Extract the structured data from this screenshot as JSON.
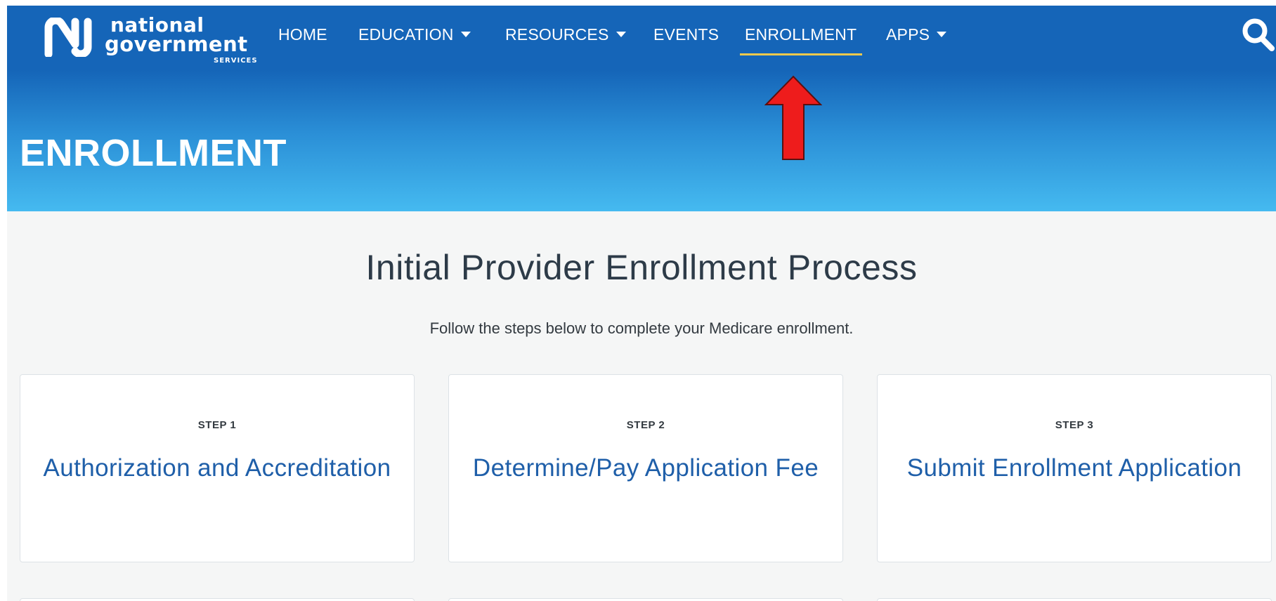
{
  "logo": {
    "line1": "national",
    "line2": "government",
    "line3": "SERVICES",
    "icon": "ngs-logo-icon"
  },
  "nav": {
    "items": [
      {
        "label": "HOME",
        "has_dropdown": false
      },
      {
        "label": "EDUCATION",
        "has_dropdown": true
      },
      {
        "label": "RESOURCES",
        "has_dropdown": true
      },
      {
        "label": "EVENTS",
        "has_dropdown": false
      },
      {
        "label": "ENROLLMENT",
        "has_dropdown": false,
        "active": true
      },
      {
        "label": "APPS",
        "has_dropdown": true
      }
    ],
    "search_icon": "search-icon"
  },
  "hero": {
    "title": "ENROLLMENT"
  },
  "annotation": {
    "icon": "red-up-arrow-icon"
  },
  "main": {
    "title": "Initial Provider Enrollment Process",
    "subtitle": "Follow the steps below to complete your Medicare enrollment.",
    "steps": [
      {
        "step": "STEP 1",
        "title": "Authorization and Accreditation"
      },
      {
        "step": "STEP 2",
        "title": "Determine/Pay Application Fee"
      },
      {
        "step": "STEP 3",
        "title": "Submit Enrollment Application"
      }
    ]
  },
  "colors": {
    "header_blue": "#1565b8",
    "hero_light_blue": "#45baf0",
    "active_underline": "#f2c94c",
    "card_title": "#1f5fa9",
    "arrow_red": "#ee1c1c",
    "page_bg": "#f5f6f6"
  }
}
